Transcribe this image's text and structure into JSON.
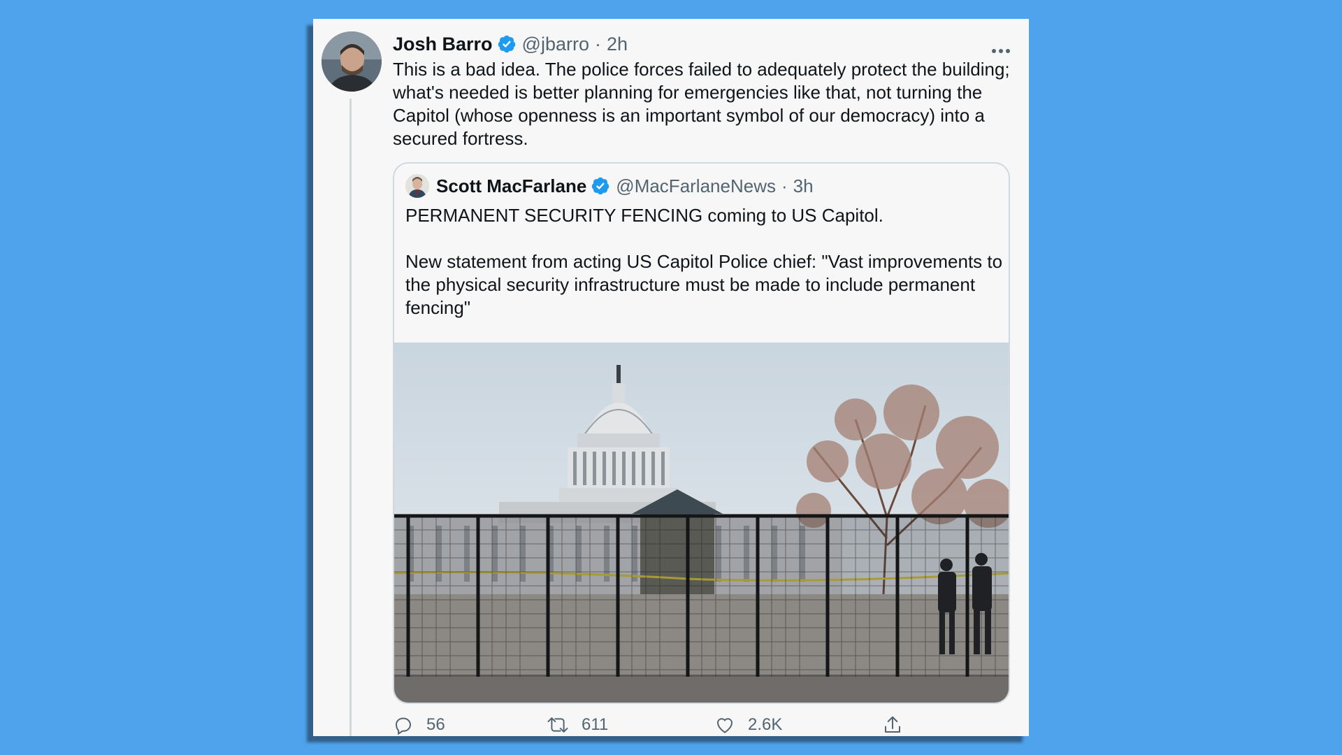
{
  "colors": {
    "background": "#4ea3ec",
    "verified": "#1d9bf0",
    "text_secondary": "#536471"
  },
  "tweet": {
    "author_name": "Josh Barro",
    "handle": "@jbarro",
    "separator": "·",
    "time": "2h",
    "more_icon": "more-horizontal-icon",
    "text": "This is a bad idea. The police forces failed to adequately protect the building; what's needed is better planning for emergencies like that, not turning the Capitol (whose openness is an important symbol of our democracy) into a secured fortress."
  },
  "quoted_tweet": {
    "author_name": "Scott MacFarlane",
    "handle": "@MacFarlaneNews",
    "separator": "·",
    "time": "3h",
    "line1": "PERMANENT SECURITY FENCING coming to US Capitol.",
    "line2": "New statement from acting US Capitol Police chief: \"Vast improvements to the physical security infrastructure must be made to include permanent fencing\""
  },
  "actions": {
    "reply_count": "56",
    "retweet_count": "611",
    "like_count": "2.6K"
  }
}
